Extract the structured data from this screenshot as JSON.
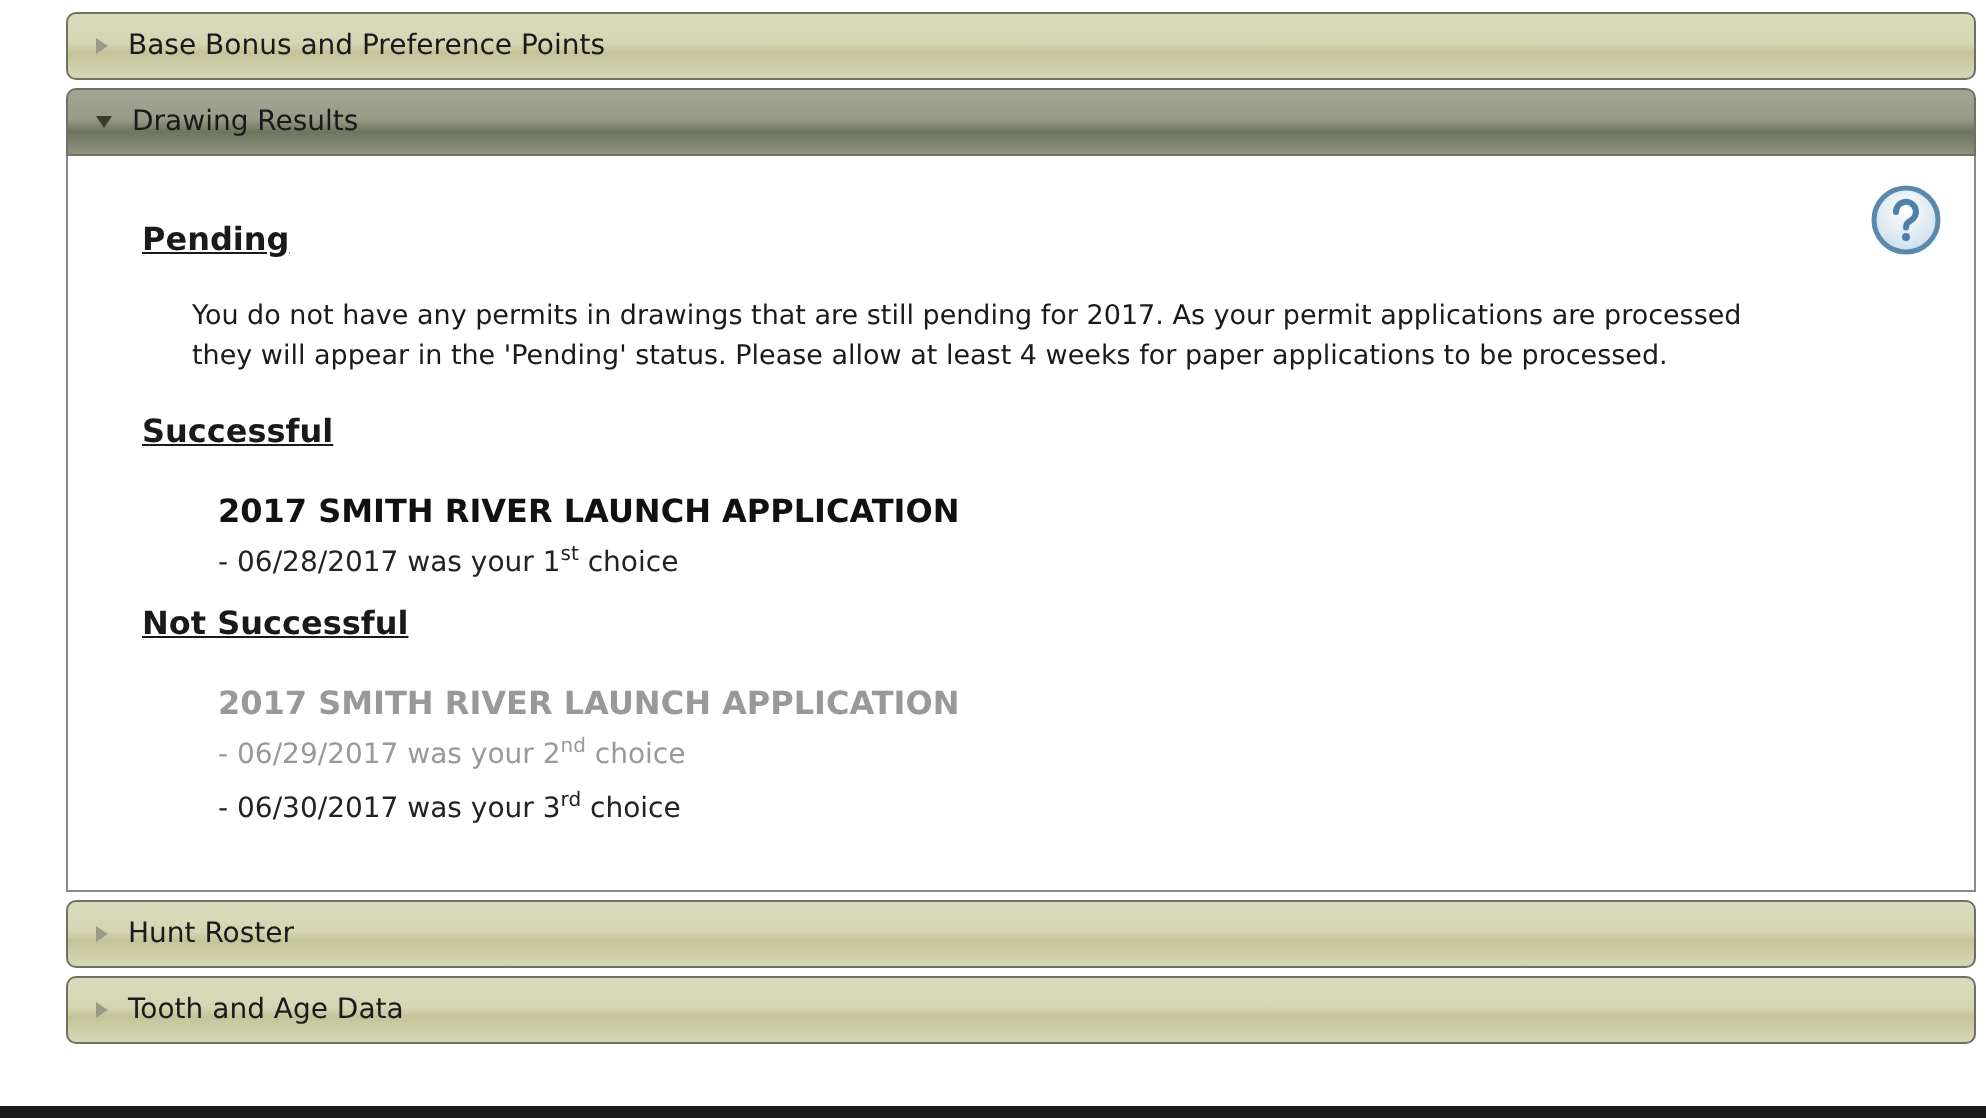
{
  "sections": [
    {
      "title": "Base Bonus and Preference Points",
      "expanded": false
    },
    {
      "title": "Drawing Results",
      "expanded": true,
      "content": {
        "pending": {
          "heading": "Pending",
          "message": "You do not have any permits in drawings that are still pending for 2017. As your permit applications are processed they will appear in the 'Pending' status. Please allow at least 4 weeks for paper applications to be processed."
        },
        "groups": [
          {
            "heading": "Successful",
            "applications": [
              {
                "name": "2017 SMITH RIVER LAUNCH APPLICATION",
                "dimmed": false,
                "choices": [
                  {
                    "text": "- 06/28/2017 was your 1$^{st}$ choice",
                    "dimmed": false
                  }
                ]
              }
            ]
          },
          {
            "heading": "Not Successful",
            "applications": [
              {
                "name": "2017 SMITH RIVER LAUNCH APPLICATION",
                "dimmed": true,
                "choices": [
                  {
                    "text": "- 06/29/2017 was your 2$^{nd}$ choice",
                    "dimmed": true
                  },
                  {
                    "text": "- 06/30/2017 was your 3$^{rd}$ choice",
                    "dimmed": false
                  }
                ]
              }
            ]
          }
        ]
      }
    },
    {
      "title": "Hunt Roster",
      "expanded": false
    },
    {
      "title": "Tooth and Age Data",
      "expanded": false
    }
  ]
}
